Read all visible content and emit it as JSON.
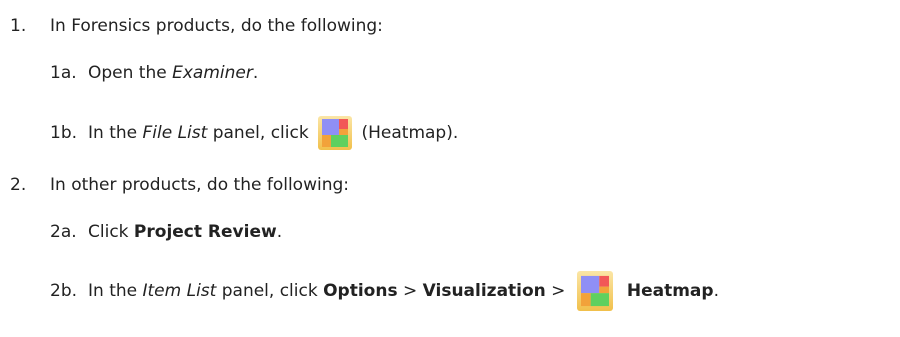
{
  "steps": [
    {
      "number": "1.",
      "text": "In Forensics products, do the following:",
      "substeps": [
        {
          "number": "1a.",
          "prefix": "Open the ",
          "emph": "Examiner",
          "suffix": "."
        },
        {
          "number": "1b.",
          "prefix": "In the ",
          "emph": "File List",
          "middle": " panel, click ",
          "icon": "heatmap-icon",
          "suffix": " (Heatmap)."
        }
      ]
    },
    {
      "number": "2.",
      "text": "In other products, do the following:",
      "substeps": [
        {
          "number": "2a.",
          "prefix": "Click ",
          "bold": "Project Review",
          "suffix": "."
        },
        {
          "number": "2b.",
          "prefix": "In the ",
          "emph": "Item List",
          "middle": " panel, click ",
          "bold1": "Options",
          "sep1": " > ",
          "bold2": "Visualization",
          "sep2": " > ",
          "icon": "heatmap-icon",
          "bold3": "Heatmap",
          "suffix": "."
        }
      ]
    }
  ],
  "icon_colors": {
    "frame_top": "#fbe6a6",
    "frame_bottom": "#f1c04b",
    "blue": "#8f8ff5",
    "red": "#f25757",
    "orange": "#f2a23a",
    "green": "#5fd05f"
  }
}
